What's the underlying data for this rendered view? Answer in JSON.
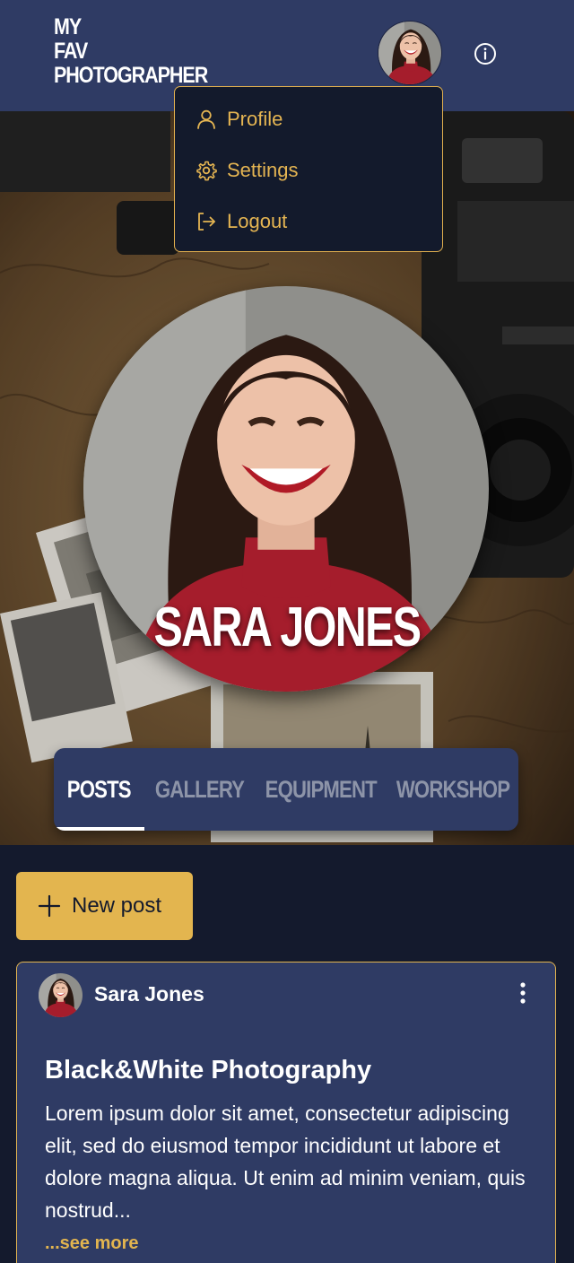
{
  "app": {
    "logo_lines": [
      "MY",
      "FAV",
      "PHOTOGRAPHER"
    ]
  },
  "header": {
    "avatar_icon": "user-avatar-photo",
    "info_icon": "info-circle-icon"
  },
  "user_menu": {
    "items": [
      {
        "label": "Profile",
        "icon": "user-icon"
      },
      {
        "label": "Settings",
        "icon": "gear-icon"
      },
      {
        "label": "Logout",
        "icon": "logout-icon"
      }
    ]
  },
  "profile": {
    "name": "SARA JONES"
  },
  "tabs": {
    "items": [
      {
        "label": "POSTS",
        "active": true
      },
      {
        "label": "GALLERY",
        "active": false
      },
      {
        "label": "EQUIPMENT",
        "active": false
      },
      {
        "label": "WORKSHOP",
        "active": false
      }
    ]
  },
  "actions": {
    "new_post_label": "New post",
    "new_post_icon": "plus-icon"
  },
  "post": {
    "author": "Sara Jones",
    "title": "Black&White Photography",
    "body": "Lorem ipsum dolor sit amet, consectetur adipiscing elit, sed do eiusmod tempor incididunt ut labore et dolore magna aliqua. Ut enim ad minim veniam, quis nostrud...",
    "see_more": "...see more",
    "menu_icon": "kebab-menu-icon"
  },
  "colors": {
    "header_bg": "#2f3b64",
    "page_bg": "#141a2d",
    "accent": "#e3b54f",
    "inactive_tab": "#8d94a8"
  }
}
